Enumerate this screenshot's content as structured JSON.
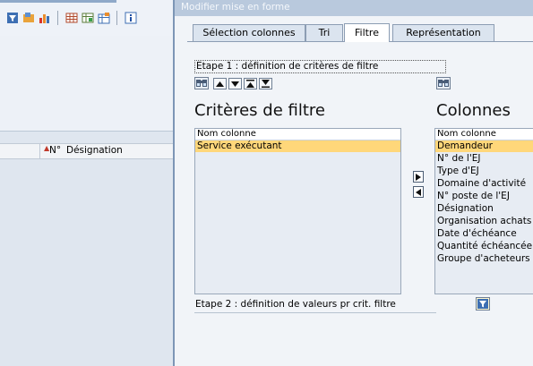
{
  "dialog": {
    "title": "Modifier mise en forme",
    "tabs": [
      {
        "label": "Sélection colonnes"
      },
      {
        "label": "Tri"
      },
      {
        "label": "Filtre",
        "active": true
      },
      {
        "label": "Représentation"
      }
    ],
    "step1": "Etape 1 : définition de critères de filtre",
    "step2": "Etape 2 : définition de valeurs pr crit. filtre",
    "criteria": {
      "title": "Critères de filtre",
      "column_header": "Nom colonne",
      "rows": [
        "Service exécutant"
      ],
      "selected_index": 0
    },
    "columns": {
      "title": "Colonnes",
      "column_header": "Nom colonne",
      "rows": [
        "Demandeur",
        "N° de l'EJ",
        "Type d'EJ",
        "Domaine d'activité",
        "N° poste de l'EJ",
        "Désignation",
        "Organisation achats",
        "Date d'échéance",
        "Quantité échéancée",
        "Groupe d'acheteurs"
      ],
      "selected_index": 0
    },
    "icons": {
      "find": "binoculars-icon",
      "up": "arrow-up-icon",
      "down": "arrow-down-icon",
      "top": "arrow-top-icon",
      "bottom": "arrow-bottom-icon",
      "move_left": "arrow-left-icon",
      "move_right": "arrow-right-icon",
      "filter": "funnel-icon"
    }
  },
  "background": {
    "table_header": {
      "number_label": "N°",
      "designation_label": "Désignation"
    }
  },
  "colors": {
    "selection": "#ffd77a",
    "titlebar": "#b9c9dd",
    "accent": "#1f4fa3"
  }
}
